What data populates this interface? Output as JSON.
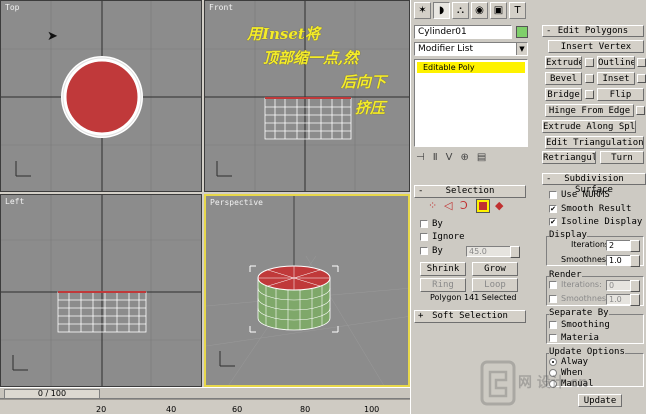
{
  "viewports": {
    "top": {
      "label": "Top"
    },
    "front": {
      "label": "Front"
    },
    "left": {
      "label": "Left"
    },
    "perspective": {
      "label": "Perspective"
    }
  },
  "annotation": {
    "line1": "用Inset将",
    "line2": "顶部缩一点,然",
    "line3": "后向下",
    "line4": "挤压"
  },
  "timeline": {
    "slider": "0 / 100",
    "ticks": [
      "20",
      "40",
      "60",
      "80",
      "100"
    ]
  },
  "command_panel": {
    "object_name": "Cylinder01",
    "modifier_list": "Modifier List",
    "stack_item": "Editable Poly",
    "edit_polygons": {
      "title": "Edit Polygons",
      "insert_vertex": "Insert Vertex",
      "extrude": "Extrude",
      "outline": "Outline",
      "bevel": "Bevel",
      "inset": "Inset",
      "bridge": "Bridge",
      "flip": "Flip",
      "hinge": "Hinge From Edge",
      "extrude_spline": "Extrude Along Spline",
      "edit_tri": "Edit Triangulation",
      "retriangulate": "Retriangulate",
      "turn": "Turn"
    },
    "selection": {
      "title": "Selection",
      "by_vertex": "By",
      "ignore": "Ignore",
      "by_angle": "By",
      "angle_value": "45.0",
      "shrink": "Shrink",
      "grow": "Grow",
      "ring": "Ring",
      "loop": "Loop",
      "status": "Polygon 141 Selected"
    },
    "soft_selection": {
      "title": "Soft Selection"
    },
    "subdivision": {
      "title": "Subdivision Surface",
      "use_nurms": "Use NURMS",
      "smooth_result": "Smooth Result",
      "isoline": "Isoline Display",
      "display_group": "Display",
      "iterations_label": "Iterations:",
      "iterations_value": "2",
      "smoothness_label": "Smoothness:",
      "smoothness_value": "1.0",
      "render_group": "Render",
      "r_iterations_value": "0",
      "r_smoothness_value": "1.0",
      "separate_group": "Separate By",
      "smoothing": "Smoothing",
      "materials": "Materia",
      "update_group": "Update Options",
      "always": "Alway",
      "when": "When",
      "manual": "Manual",
      "update_button": "Update"
    },
    "watermark": "网 设计 cn"
  },
  "colors": {
    "viewport_bg": "#8c8c8c",
    "active_border": "#e8d84a",
    "face_red": "#c0393a",
    "wire": "#ffffff",
    "annotation": "#f4ec2a"
  }
}
